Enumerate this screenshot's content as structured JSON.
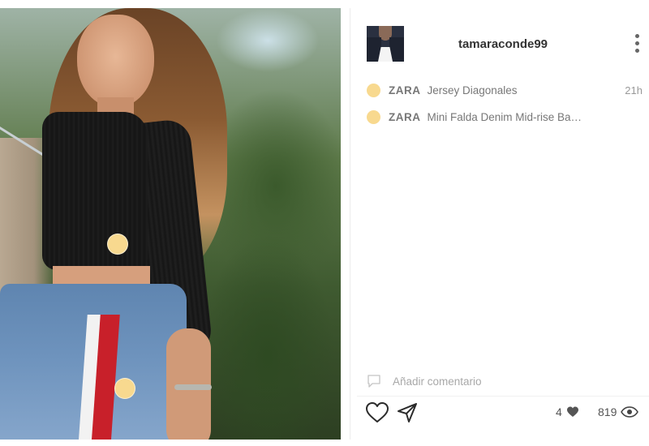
{
  "post": {
    "photo_alt": "post-photo",
    "tag_count": 2
  },
  "author": {
    "username": "tamaraconde99"
  },
  "items": [
    {
      "brand": "ZARA",
      "name": "Jersey Diagonales",
      "time": "21h"
    },
    {
      "brand": "ZARA",
      "name": "Mini Falda Denim Mid-rise Ba…",
      "time": ""
    }
  ],
  "comment": {
    "placeholder": "Añadir comentario"
  },
  "stats": {
    "likes": "4",
    "views": "819"
  },
  "colors": {
    "tag_dot": "#f8d98f",
    "brand_text": "#777777",
    "username_text": "#333333"
  },
  "icons": {
    "more": "more-vertical-icon",
    "like": "heart-outline-icon",
    "share": "send-icon",
    "comment": "comment-bubble-icon",
    "likes_stat": "heart-filled-icon",
    "views_stat": "eye-icon"
  }
}
